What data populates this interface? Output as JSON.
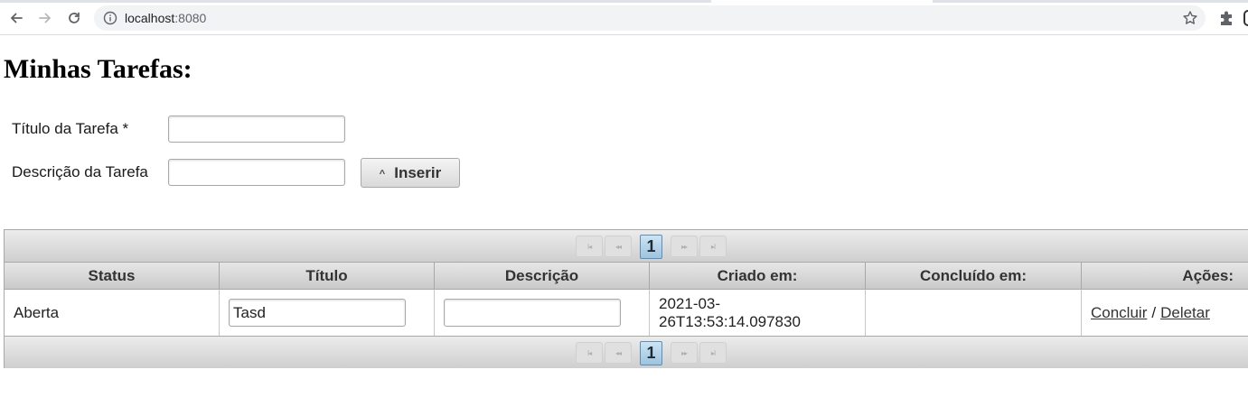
{
  "browser": {
    "url_host": "localhost",
    "url_port": ":8080"
  },
  "page": {
    "title": "Minhas Tarefas:"
  },
  "form": {
    "title_label": "Título da Tarefa *",
    "title_value": "",
    "description_label": "Descrição da Tarefa",
    "description_value": "",
    "insert_label": "Inserir",
    "insert_icon": "caret-up-icon"
  },
  "table": {
    "paginator": {
      "first": "I◂",
      "prev": "◂◂",
      "current_page": "1",
      "next": "▸▸",
      "last": "▸I"
    },
    "columns": [
      "Status",
      "Título",
      "Descrição",
      "Criado em:",
      "Concluído em:",
      "Ações:"
    ],
    "rows": [
      {
        "status": "Aberta",
        "titulo": "Tasd",
        "descricao": "",
        "criado_em_line1": "2021-03-",
        "criado_em_line2": "26T13:53:14.097830",
        "concluido_em": "",
        "action_complete": "Concluir",
        "action_separator": "/",
        "action_delete": "Deletar"
      }
    ]
  }
}
